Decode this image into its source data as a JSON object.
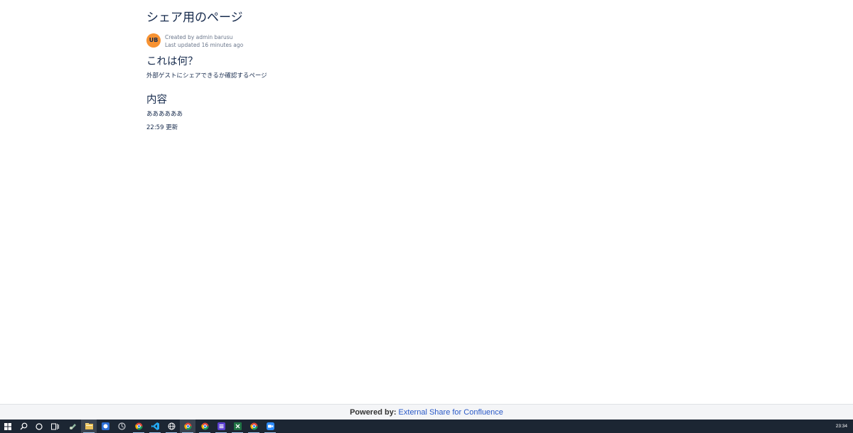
{
  "page": {
    "title": "シェア用のページ",
    "byline": {
      "avatar_initials": "UB",
      "created_by": "Created by admin barusu",
      "last_updated": "Last updated 16 minutes ago"
    },
    "sections": [
      {
        "heading": "これは何？",
        "paragraphs": [
          "外部ゲストにシェアできるか確認するページ"
        ]
      },
      {
        "heading": "内容",
        "paragraphs": [
          "ああああああ",
          "22:59 更新"
        ]
      }
    ]
  },
  "footer": {
    "powered_by_label": "Powered by:",
    "link_text": "External Share for Confluence"
  },
  "taskbar": {
    "icons": [
      "start-icon",
      "search-icon",
      "cortana-icon",
      "task-view-icon",
      "app-icon",
      "file-explorer-icon",
      "app-icon",
      "app-icon",
      "chrome-icon",
      "vscode-icon",
      "browser-icon",
      "chrome-icon",
      "chrome-icon",
      "app-icon",
      "excel-icon",
      "chrome-icon",
      "zoom-icon"
    ],
    "clock": "23:34"
  },
  "colors": {
    "avatar": "#f79232",
    "link": "#2a59c7",
    "taskbar": "#1c2633",
    "footer_bg": "#f4f5f7"
  }
}
